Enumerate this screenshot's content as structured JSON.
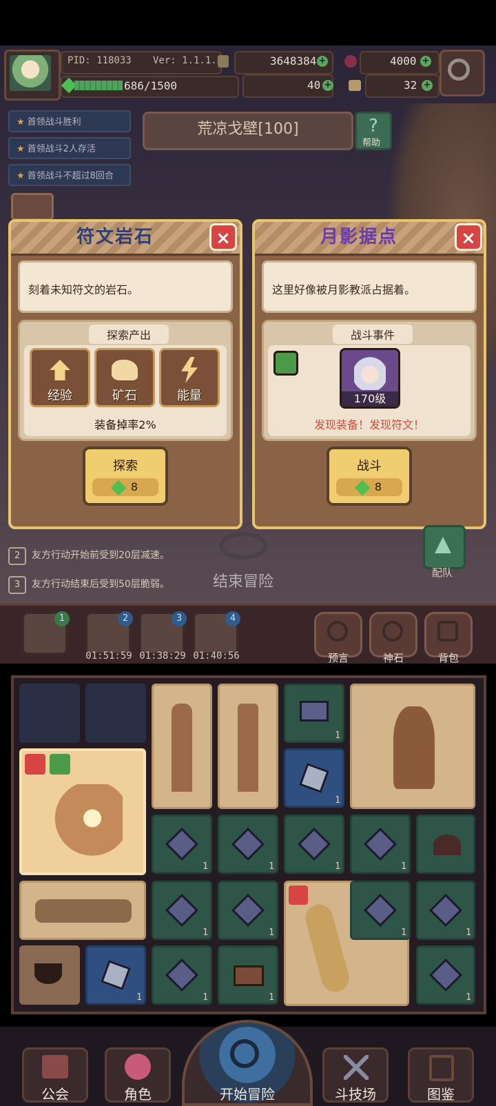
{
  "hud": {
    "pid": "PID: 118033",
    "version": "Ver: 1.1.1.5",
    "gold": "3648384",
    "gems": "4000",
    "energy": "686/1500",
    "clover": "40",
    "keys": "32",
    "energy_fraction": 0.457
  },
  "quests": [
    "首领战斗胜利",
    "首领战斗2人存活",
    "首领战斗不超过8回合"
  ],
  "location": {
    "name": "荒凉戈壁[100]",
    "help_label": "帮助",
    "help_icon_text": "?"
  },
  "panel_left": {
    "title": "符文岩石",
    "description": "刻着未知符文的岩石。",
    "section_label": "探索产出",
    "rewards": [
      "经验",
      "矿石",
      "能量"
    ],
    "drop_rate": "装备掉率2%",
    "action_label": "探索",
    "action_cost": "8",
    "close_text": "×"
  },
  "panel_right": {
    "title": "月影据点",
    "description": "这里好像被月影教派占据着。",
    "section_label": "战斗事件",
    "enemy_level": "170级",
    "discover_text": "发现装备！发现符文！",
    "action_label": "战斗",
    "action_cost": "8",
    "close_text": "×"
  },
  "effects": [
    {
      "num": "2",
      "text": "友方行动开始前受到20层减速。"
    },
    {
      "num": "3",
      "text": "友方行动结束后受到50层脆弱。"
    }
  ],
  "end_adventure": "结束冒险",
  "team_label": "配队",
  "slots": [
    {
      "num": "1",
      "timer": ""
    },
    {
      "num": "2",
      "timer": "01:51:59"
    },
    {
      "num": "3",
      "timer": "01:38:29"
    },
    {
      "num": "4",
      "timer": "01:40:56"
    }
  ],
  "side_buttons": [
    "预言",
    "神石",
    "背包"
  ],
  "grid_count": "1",
  "nav": [
    "公会",
    "角色",
    "开始冒险",
    "斗技场",
    "图鉴"
  ],
  "colors": {
    "accent_gold": "#e8c46a",
    "close_red": "#d84444",
    "discover_red": "#d64a3a",
    "title_blue": "#2c3f78",
    "title_purple": "#6a3ab0"
  }
}
